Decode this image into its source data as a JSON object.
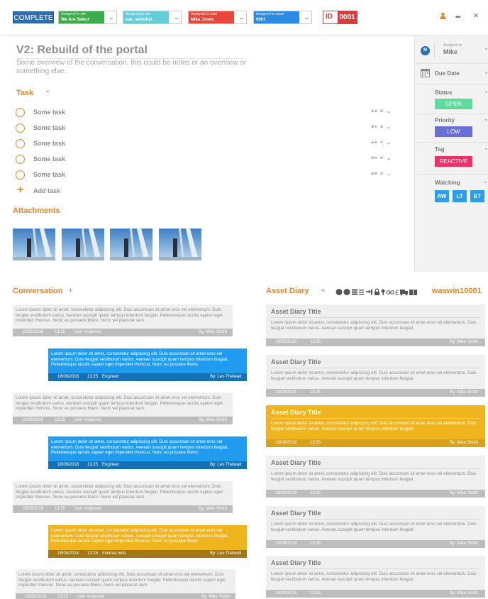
{
  "header": {
    "complete_label": "COMPLETE",
    "assignments": [
      {
        "small": "Assigned to site",
        "value": "We Are Select",
        "color": "#3daa4b"
      },
      {
        "small": "Assigned to site",
        "value": "ase_swindon",
        "color": "#63cdd8"
      },
      {
        "small": "Assigned to user",
        "value": "Mike Jones",
        "color": "#e9463c"
      },
      {
        "small": "Assigned to asset",
        "value": "0001",
        "color": "#2a8ae4"
      }
    ],
    "id_label": "ID",
    "id_value": "0001"
  },
  "main": {
    "title": "V2: Rebuild of the portal",
    "overview": "Some overview of the conversation, this could be notes or an overview or something else.",
    "task_heading": "Task",
    "tasks": [
      "Some task",
      "Some task",
      "Some task",
      "Some task",
      "Some task"
    ],
    "add_task": "Add task",
    "attachments_heading": "Attachments"
  },
  "sidebar": {
    "avatar_initial": "M",
    "assigned_small": "Assigned to",
    "assigned_name": "Mike",
    "due_date": "Due Date",
    "status_label": "Status",
    "status_value": "OPEN",
    "priority_label": "Priority",
    "priority_value": "LOW",
    "tag_label": "Tag",
    "tag_value": "REACTIVE",
    "watching_label": "Watching",
    "watchers": [
      "AW",
      "LT",
      "ET"
    ],
    "colors": {
      "open": "#5ed9a0",
      "low": "#6a6fd8",
      "reactive": "#f0306a",
      "watch": "#2a9ee9"
    }
  },
  "conversation": {
    "heading": "Conversation",
    "messages": [
      {
        "style": "grey",
        "text": "Lorem ipsum dolor sit amet, consectetur adipiscing elit. Duis accumsan sit amet eros vel elementum. Duis feugiat vestibulum varius. Aenean suscipit quam tempus interdum feugiat. Pellentesque iaculis sapien eget imperdiet rhoncus. Nunc eu posuere libero. Nunc vel placerat sem.",
        "date": "18/09/2018",
        "time": "13:25",
        "type": "User response",
        "by": "By: Mike Smith"
      },
      {
        "style": "blue",
        "text": "Lorem ipsum dolor sit amet, consectetur adipiscing elit. Duis accumsan sit amet eros vel elementum. Duis feugiat vestibulum varius. Aenean suscipit quam tempus interdum feugiat. Pellentesque iaculis sapien eget imperdiet rhoncus. Nunc eu posuere libero.",
        "date": "18/09/2018",
        "time": "13:25",
        "type": "Engineer",
        "by": "By: Leo Thelwall"
      },
      {
        "style": "grey",
        "text": "Lorem ipsum dolor sit amet, consectetur adipiscing elit. Duis accumsan sit amet eros vel elementum. Duis feugiat vestibulum varius. Aenean suscipit quam tempus interdum feugiat. Pellentesque iaculis sapien eget imperdiet rhoncus. Nunc eu posuere libero. Nunc vel placerat sem.",
        "date": "18/09/2018",
        "time": "13:25",
        "type": "User response",
        "by": "By: Mike Smith"
      },
      {
        "style": "blue",
        "text": "Lorem ipsum dolor sit amet, consectetur adipiscing elit. Duis accumsan sit amet eros vel elementum. Duis feugiat vestibulum varius. Aenean suscipit quam tempus interdum feugiat. Pellentesque iaculis sapien eget imperdiet rhoncus. Nunc eu posuere libero.",
        "date": "18/09/2018",
        "time": "13:25",
        "type": "Engineer",
        "by": "By: Leo Thelwall"
      },
      {
        "style": "grey",
        "text": "Lorem ipsum dolor sit amet, consectetur adipiscing elit. Duis accumsan sit amet eros vel elementum. Duis feugiat vestibulum varius. Aenean suscipit quam tempus interdum feugiat. Pellentesque iaculis sapien eget imperdiet rhoncus. Nunc eu posuere libero. Nunc vel placerat sem.",
        "date": "18/09/2018",
        "time": "13:25",
        "type": "User response",
        "by": "By: Mike Smith"
      },
      {
        "style": "yellow",
        "text": "Lorem ipsum dolor sit amet, consectetur adipiscing elit. Duis accumsan sit amet eros vel elementum. Duis feugiat vestibulum varius. Aenean suscipit quam tempus interdum feugiat. Pellentesque iaculis sapien eget imperdiet rhoncus. Nunc eu posuere libero.",
        "date": "18/09/2018",
        "time": "13:25",
        "type": "Internal note",
        "by": "By: Leo Thelwall"
      },
      {
        "style": "grey",
        "text": "Lorem ipsum dolor sit amet, consectetur adipiscing elit. Duis accumsan sit amet eros vel elementum. Duis feugiat vestibulum varius. Aenean suscipit quam tempus interdum feugiat. Pellentesque iaculis sapien eget imperdiet rhoncus. Nunc eu posuere libero. Nunc vel placerat sem.",
        "date": "18/09/2018",
        "time": "13:25",
        "type": "User response",
        "by": "By: Mike Smith"
      }
    ]
  },
  "diary": {
    "heading": "Asset Diary",
    "asset_code": "waswin10001",
    "entries": [
      {
        "title": "Asset Diary Title",
        "text": "Lorem ipsum dolor sit amet, consectetur adipiscing elit. Duis accumsan sit amet eros vel elementum. Duis feugiat vestibulum varius. Aenean suscipit quam tempus interdum feugiat.",
        "date": "18/09/2018",
        "time": "13:25",
        "by": "By: Mike Smith",
        "highlight": false
      },
      {
        "title": "Asset Diary Title",
        "text": "Lorem ipsum dolor sit amet, consectetur adipiscing elit. Duis accumsan sit amet eros vel elementum. Duis feugiat vestibulum varius. Aenean suscipit quam tempus interdum feugiat.",
        "date": "18/09/2018",
        "time": "13:25",
        "by": "By: Mike Smith",
        "highlight": false
      },
      {
        "title": "Asset Diary Title",
        "text": "Lorem ipsum dolor sit amet, consectetur adipiscing elit. Duis accumsan sit amet eros vel elementum. Duis feugiat vestibulum varius. Aenean suscipit quam tempus interdum feugiat.",
        "date": "18/09/2018",
        "time": "13:25",
        "by": "By: Mike Smith",
        "highlight": true
      },
      {
        "title": "Asset Diary Title",
        "text": "Lorem ipsum dolor sit amet, consectetur adipiscing elit. Duis accumsan sit amet eros vel elementum. Duis feugiat vestibulum varius. Aenean suscipit quam tempus interdum feugiat.",
        "date": "18/09/2018",
        "time": "13:25",
        "by": "By: Mike Smith",
        "highlight": false
      },
      {
        "title": "Asset Diary Title",
        "text": "Lorem ipsum dolor sit amet, consectetur adipiscing elit. Duis accumsan sit amet eros vel elementum. Duis feugiat vestibulum varius. Aenean suscipit quam tempus interdum feugiat.",
        "date": "18/09/2018",
        "time": "13:25",
        "by": "By: Mike Smith",
        "highlight": false
      },
      {
        "title": "Asset Diary Title",
        "text": "Lorem ipsum dolor sit amet, consectetur adipiscing elit. Duis accumsan sit amet eros vel elementum. Duis feugiat vestibulum varius. Aenean suscipit quam tempus interdum feugiat.",
        "date": "18/09/2018",
        "time": "13:25",
        "by": "By: Mike Smith",
        "highlight": false
      }
    ]
  },
  "icons": {
    "add": "+",
    "chevron": "⌄",
    "more": "•••",
    "close": "×",
    "lines": "≡",
    "remove": "×"
  }
}
